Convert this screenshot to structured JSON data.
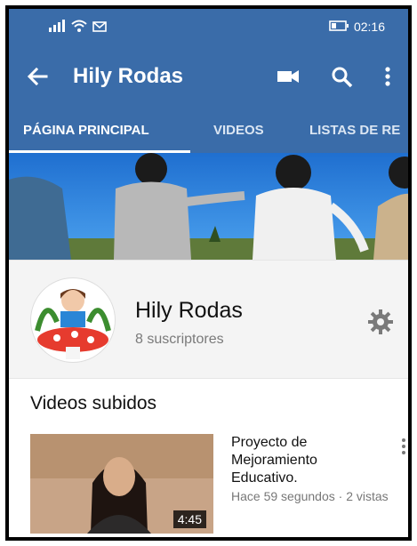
{
  "status": {
    "time": "02:16"
  },
  "appbar": {
    "title": "Hily Rodas"
  },
  "tabs": [
    "PÁGINA PRINCIPAL",
    "VIDEOS",
    "LISTAS DE RE"
  ],
  "channel": {
    "name": "Hily Rodas",
    "subscribers": "8 suscriptores"
  },
  "section": {
    "title": "Videos subidos"
  },
  "video": {
    "title": "Proyecto de Mejoramiento Educativo.",
    "meta": "Hace 59 segundos · 2 vistas",
    "duration": "4:45"
  },
  "colors": {
    "appbar": "#3a6ca9",
    "white": "#ffffff"
  },
  "icons": [
    "signal-icon",
    "wifi-icon",
    "message-icon",
    "battery-icon",
    "back-arrow-icon",
    "video-camera-icon",
    "search-icon",
    "more-vertical-icon",
    "gear-icon"
  ]
}
